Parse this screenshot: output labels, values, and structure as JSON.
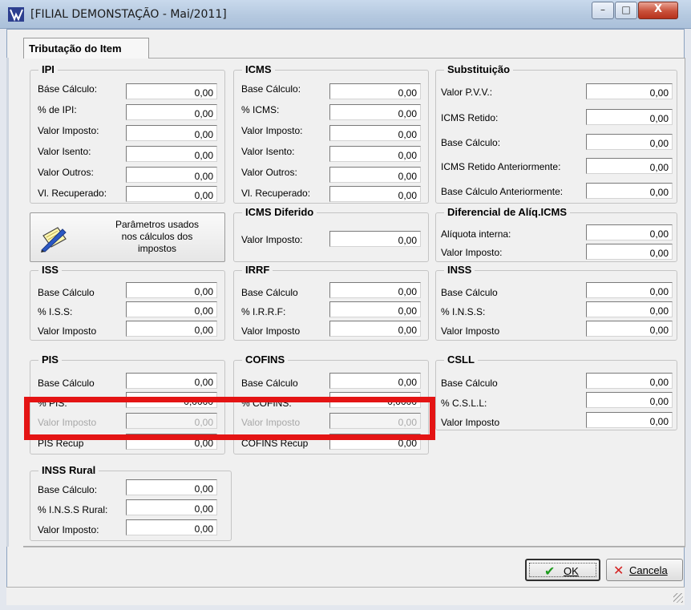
{
  "window": {
    "title": "[FILIAL DEMONSTAÇÃO - Mai/2011]",
    "close_glyph": "X",
    "minimize_glyph": "–",
    "maximize_glyph": "□"
  },
  "tab": {
    "label": "Tributação do Item"
  },
  "ipi": {
    "title": "IPI",
    "labels": [
      "Báse Cálculo:",
      "% de IPI:",
      "Valor Imposto:",
      "Valor Isento:",
      "Valor Outros:",
      "Vl. Recuperado:"
    ],
    "values": [
      "0,00",
      "0,00",
      "0,00",
      "0,00",
      "0,00",
      "0,00"
    ]
  },
  "icms": {
    "title": "ICMS",
    "labels": [
      "Base Cálculo:",
      "% ICMS:",
      "Valor Imposto:",
      "Valor Isento:",
      "Valor Outros:",
      "Vl. Recuperado:"
    ],
    "values": [
      "0,00",
      "0,00",
      "0,00",
      "0,00",
      "0,00",
      "0,00"
    ]
  },
  "substituicao": {
    "title": "Substituição",
    "labels": [
      "Valor P.V.V.:",
      "ICMS Retido:",
      "Base Cálculo:",
      "ICMS Retido Anteriormente:",
      "Base Cálculo Anteriormente:"
    ],
    "values": [
      "0,00",
      "0,00",
      "0,00",
      "0,00",
      "0,00"
    ]
  },
  "parametros": {
    "label_line1": "Parâmetros usados",
    "label_line2": "nos cálculos dos",
    "label_line3": "impostos"
  },
  "icms_diferido": {
    "title": "ICMS Diferido",
    "labels": [
      "Valor Imposto:"
    ],
    "values": [
      "0,00"
    ]
  },
  "diferencial": {
    "title": "Diferencial de Alíq.ICMS",
    "labels": [
      "Alíquota interna:",
      "Valor Imposto:"
    ],
    "values": [
      "0,00",
      "0,00"
    ]
  },
  "iss": {
    "title": "ISS",
    "labels": [
      "Base Cálculo",
      "% I.S.S:",
      "Valor Imposto"
    ],
    "values": [
      "0,00",
      "0,00",
      "0,00"
    ]
  },
  "irrf": {
    "title": "IRRF",
    "labels": [
      "Base Cálculo",
      "% I.R.R.F:",
      "Valor Imposto"
    ],
    "values": [
      "0,00",
      "0,00",
      "0,00"
    ]
  },
  "inss": {
    "title": "INSS",
    "labels": [
      "Base Cálculo",
      "% I.N.S.S:",
      "Valor Imposto"
    ],
    "values": [
      "0,00",
      "0,00",
      "0,00"
    ]
  },
  "pis": {
    "title": "PIS",
    "labels": [
      "Base Cálculo",
      "% PIS:",
      "Valor Imposto",
      "PIS Recup"
    ],
    "values": [
      "0,00",
      "0,0000",
      "0,00",
      "0,00"
    ]
  },
  "cofins": {
    "title": "COFINS",
    "labels": [
      "Base Cálculo",
      "% COFINS:",
      "Valor Imposto",
      "COFINS Recup"
    ],
    "values": [
      "0,00",
      "0,0000",
      "0,00",
      "0,00"
    ]
  },
  "csll": {
    "title": "CSLL",
    "labels": [
      "Base Cálculo",
      "% C.S.L.L:",
      "Valor Imposto"
    ],
    "values": [
      "0,00",
      "0,00",
      "0,00"
    ]
  },
  "inss_rural": {
    "title": "INSS Rural",
    "labels": [
      "Base Cálculo:",
      "% I.N.S.S Rural:",
      "Valor Imposto:"
    ],
    "values": [
      "0,00",
      "0,00",
      "0,00"
    ]
  },
  "buttons": {
    "ok": "OK",
    "cancel": "Cancela"
  },
  "colors": {
    "highlight": "#e41414",
    "ok_check": "#1e9b1e",
    "cancel_x": "#d42020"
  }
}
